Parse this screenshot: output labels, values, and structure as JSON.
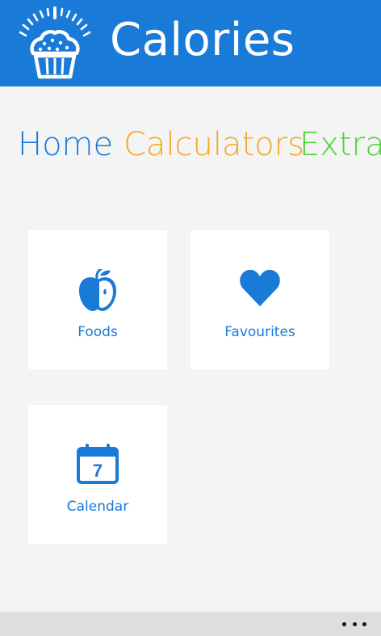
{
  "header": {
    "title": "Calories",
    "logo_icon": "cupcake-scale-icon",
    "background": "#1a7ad8"
  },
  "pivot": {
    "items": [
      {
        "label": "Home",
        "color": "#1a7ad8"
      },
      {
        "label": "Calculators",
        "color": "#f5a623"
      },
      {
        "label": "Extra",
        "color": "#4cd137"
      }
    ]
  },
  "tiles": [
    {
      "label": "Foods",
      "icon": "apple-icon"
    },
    {
      "label": "Favourites",
      "icon": "heart-icon"
    },
    {
      "label": "Calendar",
      "icon": "calendar-icon",
      "day": "7"
    }
  ],
  "appbar": {
    "more_icon": "more-options-icon"
  }
}
